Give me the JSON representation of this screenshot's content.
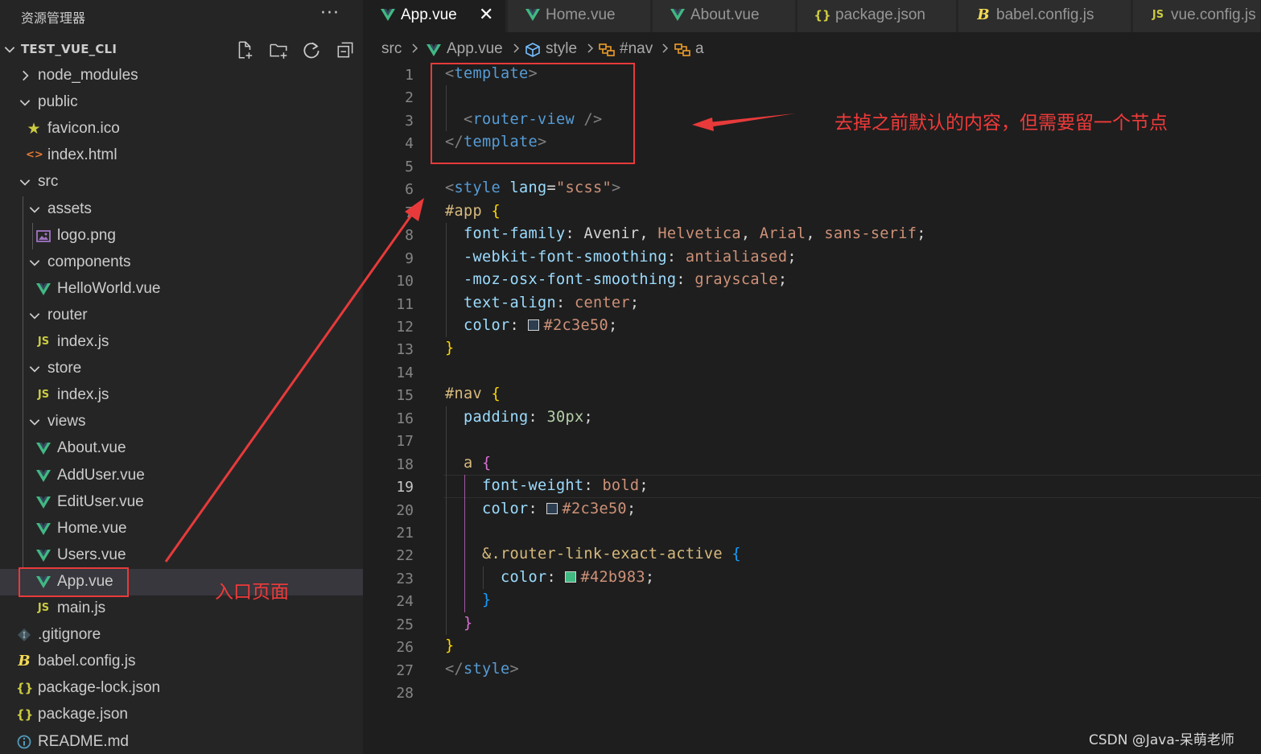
{
  "sidebar": {
    "title": "资源管理器",
    "more_actions": "···",
    "project": "TEST_VUE_CLI",
    "header_icons": [
      "new-file-icon",
      "new-folder-icon",
      "refresh-icon",
      "collapse-all-icon"
    ],
    "items": [
      {
        "label": "node_modules",
        "kind": "folder",
        "expanded": false
      },
      {
        "label": "public",
        "kind": "folder",
        "expanded": true
      },
      {
        "label": "favicon.ico",
        "kind": "file",
        "icon": "star-icon"
      },
      {
        "label": "index.html",
        "kind": "file",
        "icon": "html-icon"
      },
      {
        "label": "src",
        "kind": "folder",
        "expanded": true
      },
      {
        "label": "assets",
        "kind": "folder",
        "expanded": true
      },
      {
        "label": "logo.png",
        "kind": "file",
        "icon": "image-icon"
      },
      {
        "label": "components",
        "kind": "folder",
        "expanded": true
      },
      {
        "label": "HelloWorld.vue",
        "kind": "file",
        "icon": "vue-icon"
      },
      {
        "label": "router",
        "kind": "folder",
        "expanded": true
      },
      {
        "label": "index.js",
        "kind": "file",
        "icon": "js-icon"
      },
      {
        "label": "store",
        "kind": "folder",
        "expanded": true
      },
      {
        "label": "index.js",
        "kind": "file",
        "icon": "js-icon"
      },
      {
        "label": "views",
        "kind": "folder",
        "expanded": true
      },
      {
        "label": "About.vue",
        "kind": "file",
        "icon": "vue-icon"
      },
      {
        "label": "AddUser.vue",
        "kind": "file",
        "icon": "vue-icon"
      },
      {
        "label": "EditUser.vue",
        "kind": "file",
        "icon": "vue-icon"
      },
      {
        "label": "Home.vue",
        "kind": "file",
        "icon": "vue-icon"
      },
      {
        "label": "Users.vue",
        "kind": "file",
        "icon": "vue-icon"
      },
      {
        "label": "App.vue",
        "kind": "file",
        "icon": "vue-icon",
        "selected": true
      },
      {
        "label": "main.js",
        "kind": "file",
        "icon": "js-icon"
      },
      {
        "label": ".gitignore",
        "kind": "file",
        "icon": "git-icon"
      },
      {
        "label": "babel.config.js",
        "kind": "file",
        "icon": "babel-icon"
      },
      {
        "label": "package-lock.json",
        "kind": "file",
        "icon": "json-icon"
      },
      {
        "label": "package.json",
        "kind": "file",
        "icon": "json-icon"
      },
      {
        "label": "README.md",
        "kind": "file",
        "icon": "info-icon"
      }
    ]
  },
  "tabs": [
    {
      "label": "App.vue",
      "icon": "vue-icon",
      "active": true,
      "close": "✕"
    },
    {
      "label": "Home.vue",
      "icon": "vue-icon"
    },
    {
      "label": "About.vue",
      "icon": "vue-icon"
    },
    {
      "label": "package.json",
      "icon": "json-icon"
    },
    {
      "label": "babel.config.js",
      "icon": "babel-icon"
    },
    {
      "label": "vue.config.js",
      "icon": "js-icon"
    }
  ],
  "breadcrumb": [
    "src",
    "App.vue",
    "style",
    "#nav",
    "a"
  ],
  "editor": {
    "current_line": 19,
    "line_numbers": [
      "1",
      "2",
      "3",
      "4",
      "5",
      "6",
      "7",
      "8",
      "9",
      "10",
      "11",
      "12",
      "13",
      "14",
      "15",
      "16",
      "17",
      "18",
      "19",
      "20",
      "21",
      "22",
      "23",
      "24",
      "25",
      "26",
      "27",
      "28"
    ],
    "lines": [
      [
        [
          "t-punc",
          "<"
        ],
        [
          "t-tag",
          "template"
        ],
        [
          "t-punc",
          ">"
        ]
      ],
      [],
      [
        [
          "t-plain",
          "  "
        ],
        [
          "t-punc",
          "<"
        ],
        [
          "t-tag",
          "router-view"
        ],
        [
          "t-plain",
          " "
        ],
        [
          "t-punc",
          "/>"
        ]
      ],
      [
        [
          "t-punc",
          "</"
        ],
        [
          "t-tag",
          "template"
        ],
        [
          "t-punc",
          ">"
        ]
      ],
      [],
      [
        [
          "t-punc",
          "<"
        ],
        [
          "t-tag",
          "style"
        ],
        [
          "t-plain",
          " "
        ],
        [
          "t-attr",
          "lang"
        ],
        [
          "t-plain",
          "="
        ],
        [
          "t-str",
          "\"scss\""
        ],
        [
          "t-punc",
          ">"
        ]
      ],
      [
        [
          "t-sel",
          "#app"
        ],
        [
          "t-plain",
          " "
        ],
        [
          "t-brace",
          "{"
        ]
      ],
      [
        [
          "t-plain",
          "  "
        ],
        [
          "t-prop",
          "font-family"
        ],
        [
          "t-plain",
          ": Avenir, "
        ],
        [
          "t-val",
          "Helvetica"
        ],
        [
          "t-plain",
          ", "
        ],
        [
          "t-val",
          "Arial"
        ],
        [
          "t-plain",
          ", "
        ],
        [
          "t-val",
          "sans-serif"
        ],
        [
          "t-plain",
          ";"
        ]
      ],
      [
        [
          "t-plain",
          "  "
        ],
        [
          "t-prop",
          "-webkit-font-smoothing"
        ],
        [
          "t-plain",
          ": "
        ],
        [
          "t-val",
          "antialiased"
        ],
        [
          "t-plain",
          ";"
        ]
      ],
      [
        [
          "t-plain",
          "  "
        ],
        [
          "t-prop",
          "-moz-osx-font-smoothing"
        ],
        [
          "t-plain",
          ": "
        ],
        [
          "t-val",
          "grayscale"
        ],
        [
          "t-plain",
          ";"
        ]
      ],
      [
        [
          "t-plain",
          "  "
        ],
        [
          "t-prop",
          "text-align"
        ],
        [
          "t-plain",
          ": "
        ],
        [
          "t-val",
          "center"
        ],
        [
          "t-plain",
          ";"
        ]
      ],
      [
        [
          "t-plain",
          "  "
        ],
        [
          "t-prop",
          "color"
        ],
        [
          "t-plain",
          ": "
        ],
        [
          "swatch",
          "#2c3e50"
        ],
        [
          "t-val",
          "#2c3e50"
        ],
        [
          "t-plain",
          ";"
        ]
      ],
      [
        [
          "t-brace",
          "}"
        ]
      ],
      [],
      [
        [
          "t-sel",
          "#nav"
        ],
        [
          "t-plain",
          " "
        ],
        [
          "t-brace",
          "{"
        ]
      ],
      [
        [
          "t-plain",
          "  "
        ],
        [
          "t-prop",
          "padding"
        ],
        [
          "t-plain",
          ": "
        ],
        [
          "t-num",
          "30px"
        ],
        [
          "t-plain",
          ";"
        ]
      ],
      [],
      [
        [
          "t-plain",
          "  "
        ],
        [
          "t-sel",
          "a"
        ],
        [
          "t-plain",
          " "
        ],
        [
          "t-brace2",
          "{"
        ]
      ],
      [
        [
          "t-plain",
          "    "
        ],
        [
          "t-prop",
          "font-weight"
        ],
        [
          "t-plain",
          ": "
        ],
        [
          "t-val",
          "bold"
        ],
        [
          "t-plain",
          ";"
        ]
      ],
      [
        [
          "t-plain",
          "    "
        ],
        [
          "t-prop",
          "color"
        ],
        [
          "t-plain",
          ": "
        ],
        [
          "swatch",
          "#2c3e50"
        ],
        [
          "t-val",
          "#2c3e50"
        ],
        [
          "t-plain",
          ";"
        ]
      ],
      [],
      [
        [
          "t-plain",
          "    "
        ],
        [
          "t-sel",
          "&.router-link-exact-active"
        ],
        [
          "t-plain",
          " "
        ],
        [
          "t-brace3",
          "{"
        ]
      ],
      [
        [
          "t-plain",
          "      "
        ],
        [
          "t-prop",
          "color"
        ],
        [
          "t-plain",
          ": "
        ],
        [
          "swatch",
          "#42b983"
        ],
        [
          "t-val",
          "#42b983"
        ],
        [
          "t-plain",
          ";"
        ]
      ],
      [
        [
          "t-plain",
          "    "
        ],
        [
          "t-brace3",
          "}"
        ]
      ],
      [
        [
          "t-plain",
          "  "
        ],
        [
          "t-brace2",
          "}"
        ]
      ],
      [
        [
          "t-brace",
          "}"
        ]
      ],
      [
        [
          "t-punc",
          "</"
        ],
        [
          "t-tag",
          "style"
        ],
        [
          "t-punc",
          ">"
        ]
      ],
      []
    ]
  },
  "annotations": {
    "entry_label": "入口页面",
    "template_note": "去掉之前默认的内容，但需要留一个节点"
  },
  "watermark": "CSDN @Java-呆萌老师",
  "colors": {
    "vue": "#41b883",
    "js": "#cbcb41",
    "json": "#cbcb41",
    "babel": "#f5da55",
    "html": "#e37933",
    "annotation": "#e83a3a",
    "sidebar_bg": "#252526",
    "editor_bg": "#1e1e1e"
  }
}
